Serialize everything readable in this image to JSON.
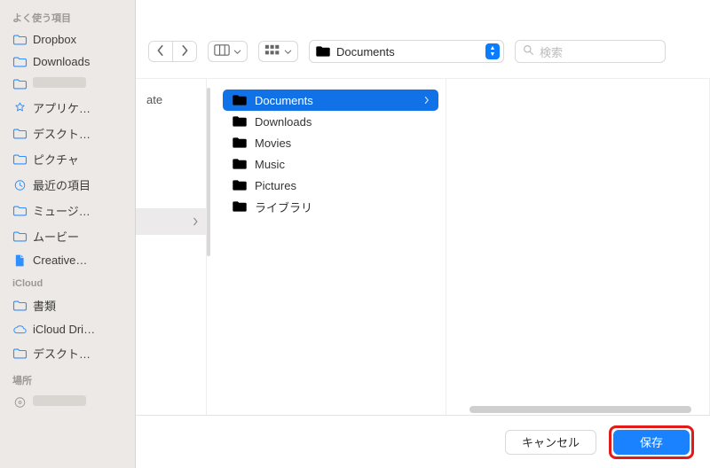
{
  "sidebar": {
    "sections": [
      {
        "title": "よく使う項目",
        "items": [
          {
            "icon": "folder",
            "label": "Dropbox"
          },
          {
            "icon": "folder",
            "label": "Downloads"
          },
          {
            "icon": "folder",
            "label": ""
          },
          {
            "icon": "app",
            "label": "アプリケ…"
          },
          {
            "icon": "folder",
            "label": "デスクト…"
          },
          {
            "icon": "folder",
            "label": "ピクチャ"
          },
          {
            "icon": "clock",
            "label": "最近の項目"
          },
          {
            "icon": "folder",
            "label": "ミュージ…"
          },
          {
            "icon": "folder",
            "label": "ムービー"
          },
          {
            "icon": "document",
            "label": "Creative…"
          }
        ]
      },
      {
        "title": "iCloud",
        "items": [
          {
            "icon": "folder",
            "label": "書類"
          },
          {
            "icon": "cloud",
            "label": "iCloud Dri…"
          },
          {
            "icon": "folder",
            "label": "デスクト…"
          }
        ]
      },
      {
        "title": "場所",
        "items": [
          {
            "icon": "disk",
            "label": ""
          }
        ]
      }
    ]
  },
  "toolbar": {
    "location_label": "Documents",
    "search_placeholder": "検索"
  },
  "column1": {
    "partial_label": "ate"
  },
  "column2": {
    "folders": [
      {
        "label": "Documents",
        "selected": true
      },
      {
        "label": "Downloads",
        "selected": false
      },
      {
        "label": "Movies",
        "selected": false
      },
      {
        "label": "Music",
        "selected": false
      },
      {
        "label": "Pictures",
        "selected": false
      },
      {
        "label": "ライブラリ",
        "selected": false
      }
    ]
  },
  "footer": {
    "cancel_label": "キャンセル",
    "save_label": "保存"
  }
}
